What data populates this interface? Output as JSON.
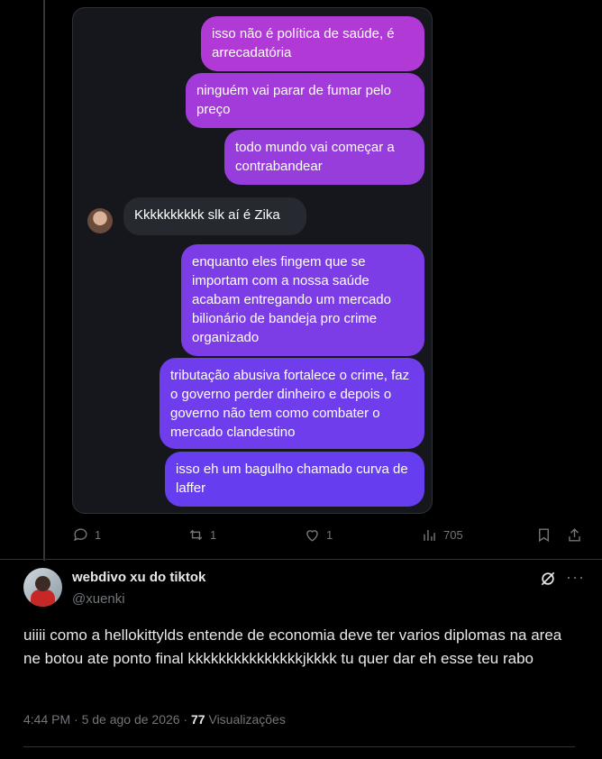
{
  "chat": {
    "messages": [
      {
        "text": "isso não é política de saúde, é arrecadatória"
      },
      {
        "text": "ninguém vai parar de fumar pelo preço"
      },
      {
        "text": "todo mundo vai começar a contrabandear"
      },
      {
        "text": "Kkkkkkkkkk slk aí é Zika"
      },
      {
        "text": "enquanto eles fingem que se importam com a nossa saúde acabam entregando um mercado bilionário de bandeja pro crime organizado"
      },
      {
        "text": "tributação abusiva fortalece o crime, faz o governo perder dinheiro e depois o governo não tem como combater o mercado clandestino"
      },
      {
        "text": "isso eh um bagulho chamado curva de laffer"
      }
    ],
    "colors": {
      "gradient_top": "#b23bd8",
      "gradient_bottom": "#6a3cf0",
      "incoming": "#262a30"
    }
  },
  "actions": {
    "replies": "1",
    "reposts": "1",
    "likes": "1",
    "views": "705"
  },
  "post": {
    "display_name": "webdivo xu do tiktok",
    "handle": "@xuenki",
    "text": "uiiii como a hellokittylds entende de economia deve ter varios diplomas na area ne botou ate ponto final kkkkkkkkkkkkkkkjkkkk tu quer dar eh esse teu rabo",
    "time": "4:44 PM · 5 de ago de 2026 · ",
    "views_count": "77",
    "views_label": " Visualizações"
  }
}
